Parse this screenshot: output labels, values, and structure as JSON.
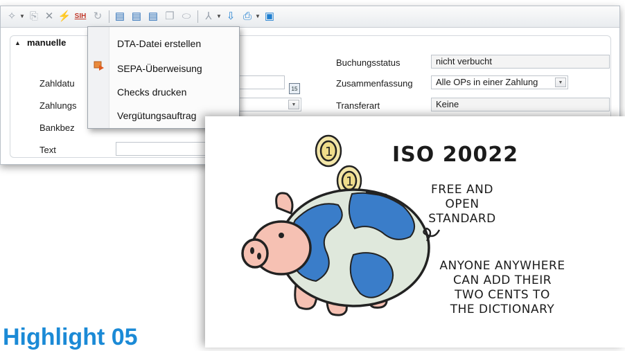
{
  "toolbar": {
    "buttons": [
      {
        "icon": "wand-icon"
      },
      {
        "icon": "copy-icon"
      },
      {
        "icon": "delete-icon"
      },
      {
        "icon": "lightning-icon"
      },
      {
        "icon": "sih-icon",
        "label": "SIH"
      },
      {
        "icon": "refresh-icon"
      },
      {
        "icon": "new-doc-icon"
      },
      {
        "icon": "edit-doc-icon"
      },
      {
        "icon": "remove-doc-icon"
      },
      {
        "icon": "duplicate-icon"
      },
      {
        "icon": "eraser-icon"
      },
      {
        "icon": "filter-icon"
      },
      {
        "icon": "import-icon"
      },
      {
        "icon": "print-icon"
      },
      {
        "icon": "save-icon"
      }
    ]
  },
  "group": {
    "title": "manuelle",
    "labels": {
      "zahldatum": "Zahldatu",
      "zahlungs": "Zahlungs",
      "bankbez": "Bankbez",
      "text": "Text"
    }
  },
  "right_fields": [
    {
      "label": "Buchungsstatus",
      "value": "nicht verbucht"
    },
    {
      "label": "Zusammenfassung",
      "value": "Alle OPs in einer Zahlung"
    },
    {
      "label": "Transferart",
      "value": "Keine"
    }
  ],
  "menu": {
    "items": [
      {
        "label": "DTA-Datei erstellen"
      },
      {
        "label": "SEPA-Überweisung"
      },
      {
        "label": "Checks drucken"
      },
      {
        "label": "Vergütungsauftrag"
      }
    ]
  },
  "cartoon": {
    "title": "ISO 20022",
    "subtitle": [
      "FREE AND",
      "OPEN STANDARD"
    ],
    "caption": [
      "ANYONE ANYWHERE",
      "CAN ADD THEIR",
      "TWO CENTS TO",
      "THE DICTIONARY"
    ]
  },
  "highlight": "Highlight 05",
  "colors": {
    "highlight": "#1b8ad6",
    "toolbar_accent": "#1f7fd0"
  }
}
